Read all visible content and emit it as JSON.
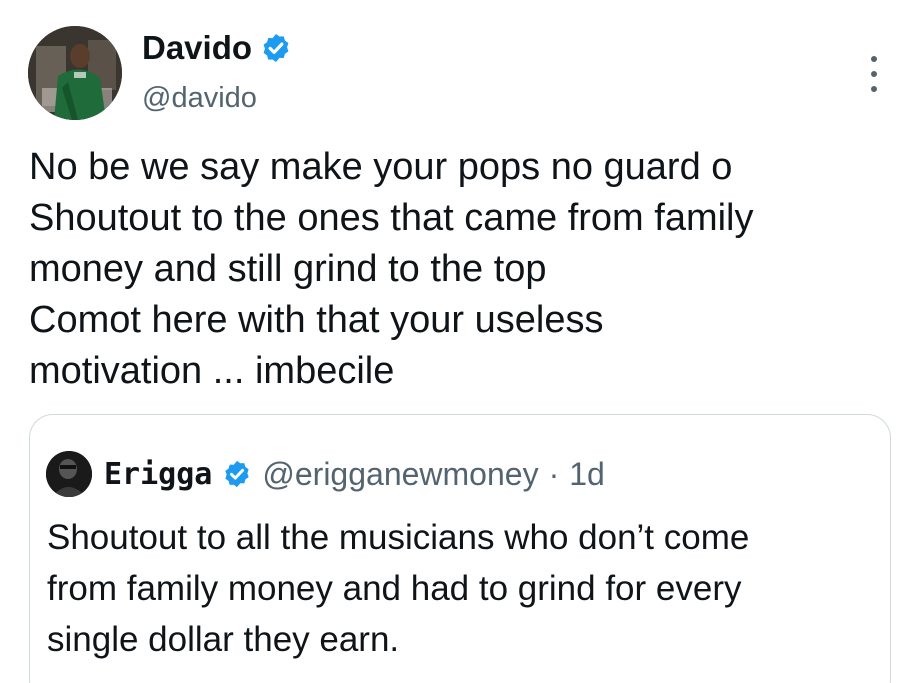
{
  "author": {
    "name": "Davido",
    "handle": "@davido",
    "verified": true,
    "avatar": "profile-photo"
  },
  "tweet": {
    "lines": [
      "No be we say make your pops no guard o",
      "Shoutout to the ones that came from family",
      "money and still grind to the top",
      "Comot here with that your useless",
      "motivation ... imbecile"
    ]
  },
  "quoted_tweet": {
    "name": "Erigga",
    "handle": "@erigganewmoney",
    "separator": "·",
    "time": "1d",
    "verified": true,
    "lines": [
      "Shoutout to all the musicians who don’t come",
      "from family money and had to grind for every",
      "single dollar they earn."
    ]
  },
  "icons": {
    "verified": "verified-badge-icon",
    "more": "more-options-icon"
  },
  "colors": {
    "verified_blue": "#1d9bf0",
    "primary_text": "#0f1419",
    "secondary_text": "#536471",
    "border": "#cfd9de"
  }
}
